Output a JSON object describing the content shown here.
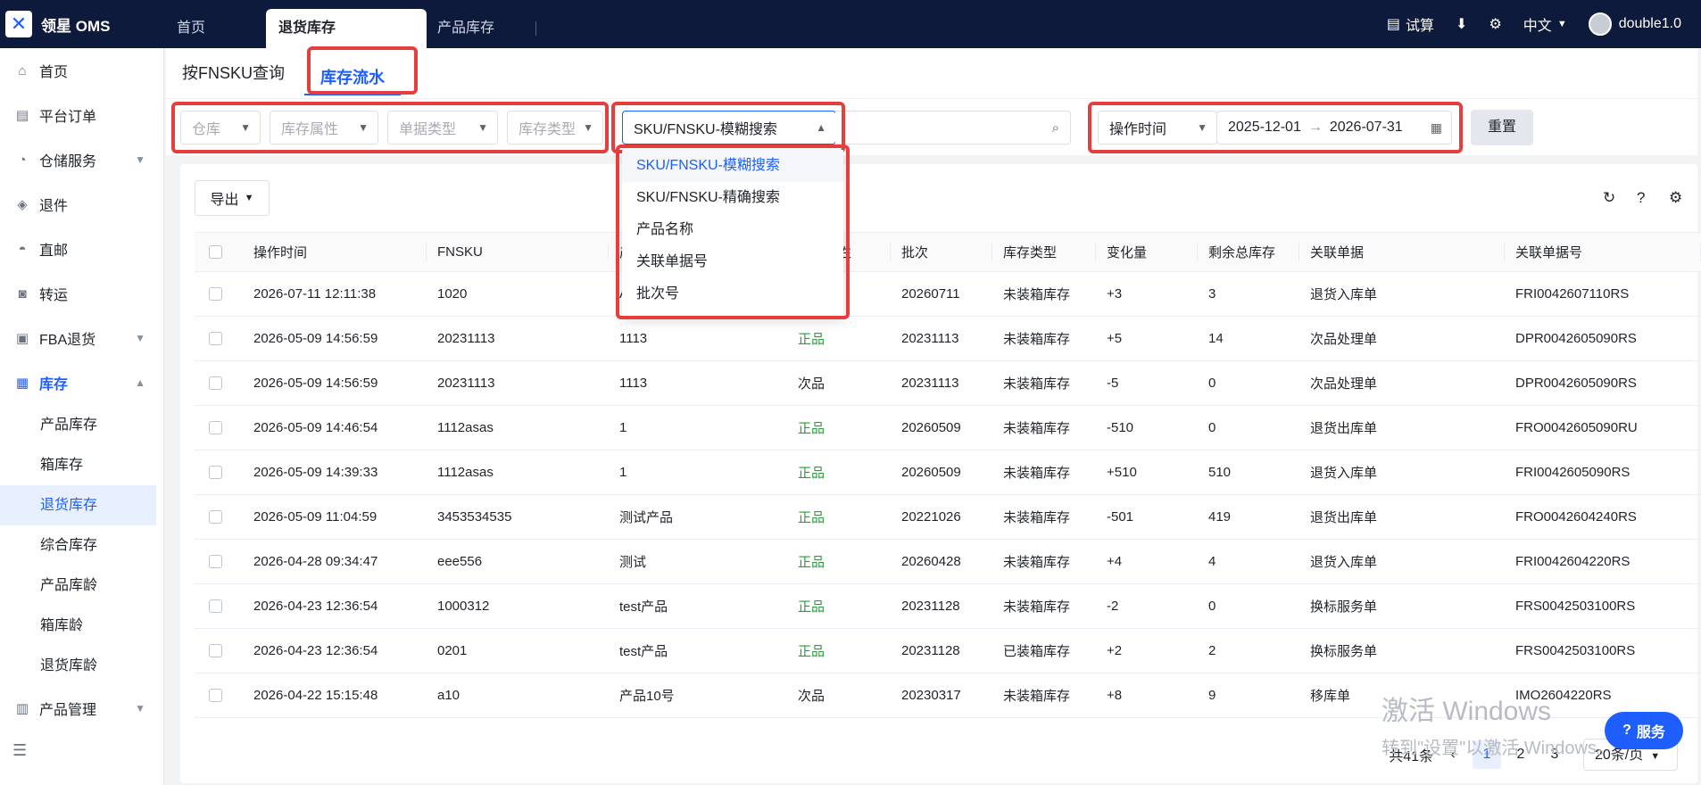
{
  "topbar": {
    "logo_text": "领星 OMS",
    "tabs": [
      {
        "label": "首页"
      },
      {
        "label": "退货库存"
      },
      {
        "label": "产品库存"
      }
    ],
    "trial": "试算",
    "language": "中文",
    "username": "double1.0"
  },
  "sidebar": {
    "items": [
      {
        "label": "首页",
        "icon": "home-icon"
      },
      {
        "label": "平台订单",
        "icon": "orders-icon"
      },
      {
        "label": "仓储服务",
        "icon": "warehouse-icon"
      },
      {
        "label": "退件",
        "icon": "return-icon"
      },
      {
        "label": "直邮",
        "icon": "mail-icon"
      },
      {
        "label": "转运",
        "icon": "transfer-icon"
      },
      {
        "label": "FBA退货",
        "icon": "fba-icon"
      },
      {
        "label": "库存",
        "icon": "inventory-icon"
      }
    ],
    "inventory_subitems": [
      "产品库存",
      "箱库存",
      "退货库存",
      "综合库存",
      "产品库龄",
      "箱库龄",
      "退货库龄"
    ],
    "product_mgmt": "产品管理"
  },
  "subtabs": {
    "by_fnsku": "按FNSKU查询",
    "flow": "库存流水"
  },
  "filters": {
    "warehouse": "仓库",
    "stock_attr": "库存属性",
    "doc_type": "单据类型",
    "stock_type": "库存类型",
    "search_mode": "SKU/FNSKU-模糊搜索",
    "time_field": "操作时间",
    "date_start": "2025-12-01",
    "date_end": "2026-07-31",
    "reset": "重置"
  },
  "dropdown": {
    "options": [
      "SKU/FNSKU-模糊搜索",
      "SKU/FNSKU-精确搜索",
      "产品名称",
      "关联单据号",
      "批次号"
    ]
  },
  "toolbar": {
    "export": "导出"
  },
  "table": {
    "headers": [
      "操作时间",
      "FNSKU",
      "产品",
      "库存属性",
      "批次",
      "库存类型",
      "变化量",
      "剩余总库存",
      "关联单据",
      "关联单据号"
    ],
    "rows": [
      [
        "2026-07-11 12:11:38",
        "1020",
        "A-3",
        "",
        "20260711",
        "未装箱库存",
        "+3",
        "3",
        "退货入库单",
        "FRI0042607110RS"
      ],
      [
        "2026-05-09 14:56:59",
        "20231113",
        "1113",
        "正品",
        "20231113",
        "未装箱库存",
        "+5",
        "14",
        "次品处理单",
        "DPR0042605090RS"
      ],
      [
        "2026-05-09 14:56:59",
        "20231113",
        "1113",
        "次品",
        "20231113",
        "未装箱库存",
        "-5",
        "0",
        "次品处理单",
        "DPR0042605090RS"
      ],
      [
        "2026-05-09 14:46:54",
        "1112asas",
        "1",
        "正品",
        "20260509",
        "未装箱库存",
        "-510",
        "0",
        "退货出库单",
        "FRO0042605090RU"
      ],
      [
        "2026-05-09 14:39:33",
        "1112asas",
        "1",
        "正品",
        "20260509",
        "未装箱库存",
        "+510",
        "510",
        "退货入库单",
        "FRI0042605090RS"
      ],
      [
        "2026-05-09 11:04:59",
        "3453534535",
        "测试产品",
        "正品",
        "20221026",
        "未装箱库存",
        "-501",
        "419",
        "退货出库单",
        "FRO0042604240RS"
      ],
      [
        "2026-04-28 09:34:47",
        "eee556",
        "测试",
        "正品",
        "20260428",
        "未装箱库存",
        "+4",
        "4",
        "退货入库单",
        "FRI0042604220RS"
      ],
      [
        "2026-04-23 12:36:54",
        "1000312",
        "test产品",
        "正品",
        "20231128",
        "未装箱库存",
        "-2",
        "0",
        "换标服务单",
        "FRS0042503100RS"
      ],
      [
        "2026-04-23 12:36:54",
        "0201",
        "test产品",
        "正品",
        "20231128",
        "已装箱库存",
        "+2",
        "2",
        "换标服务单",
        "FRS0042503100RS"
      ],
      [
        "2026-04-22 15:15:48",
        "a10",
        "产品10号",
        "次品",
        "20230317",
        "未装箱库存",
        "+8",
        "9",
        "移库单",
        "IMO2604220RS"
      ]
    ]
  },
  "pagination": {
    "total": "共41条",
    "pages": [
      "1",
      "2",
      "3"
    ],
    "page_size": "20条/页"
  },
  "service_button": "服务",
  "os_watermark": {
    "line1": "激活 Windows",
    "line2": "转到\"设置\"以激活 Windows。"
  },
  "colors": {
    "accent": "#1e5eff",
    "topbar": "#0e1a3c",
    "highlight": "#e53e3e",
    "good": "#2a9d3a"
  }
}
